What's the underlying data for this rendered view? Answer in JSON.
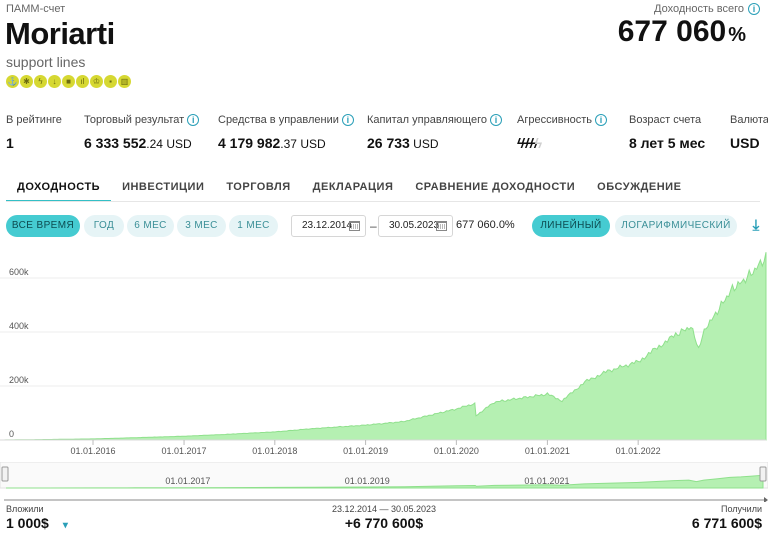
{
  "header": {
    "account_type": "ПАММ-счет",
    "name": "Moriarti",
    "subtitle": "support lines",
    "badge_icons": [
      "anchor-icon",
      "fire-icon",
      "bolt-icon",
      "pin-icon",
      "briefcase-icon",
      "chart-icon",
      "award-icon",
      "lock-icon",
      "building-icon"
    ],
    "yield_label": "Доходность всего",
    "yield_value": "677 060",
    "yield_unit": "%"
  },
  "stats": {
    "rating": {
      "label": "В рейтинге",
      "value": "1"
    },
    "trade_result": {
      "label": "Торговый результат",
      "int": "6 333 552",
      "dec": ".24",
      "cur": " USD"
    },
    "managed": {
      "label": "Средства в управлении",
      "int": "4 179 982",
      "dec": ".37",
      "cur": " USD"
    },
    "manager_capital": {
      "label": "Капитал управляющего",
      "int": "26 733",
      "cur": " USD"
    },
    "aggressiveness": {
      "label": "Агрессивность",
      "level": 4,
      "max": 5
    },
    "age": {
      "label": "Возраст счета",
      "value": "8 лет 5 мес"
    },
    "currency": {
      "label": "Валюта",
      "value": "USD"
    }
  },
  "tabs": [
    "ДОХОДНОСТЬ",
    "ИНВЕСТИЦИИ",
    "ТОРГОВЛЯ",
    "ДЕКЛАРАЦИЯ",
    "СРАВНЕНИЕ ДОХОДНОСТИ",
    "ОБСУЖДЕНИЕ"
  ],
  "filters": {
    "periods": [
      "ВСЕ ВРЕМЯ",
      "ГОД",
      "6 МЕС",
      "3 МЕС",
      "1 МЕС"
    ],
    "active_period": "ВСЕ ВРЕМЯ",
    "date_from": "23.12.2014",
    "dash": "–",
    "date_to": "30.05.2023",
    "range_yield": "677 060.0%",
    "scales": [
      "ЛИНЕЙНЫЙ",
      "ЛОГАРИФМИЧЕСКИЙ"
    ],
    "active_scale": "ЛИНЕЙНЫЙ"
  },
  "chart_data": {
    "type": "area",
    "title": "",
    "xlabel": "",
    "ylabel": "",
    "y_ticks": [
      0,
      200000,
      400000,
      600000
    ],
    "y_tick_labels": [
      "0",
      "200k",
      "400k",
      "600k"
    ],
    "ylim": [
      0,
      700000
    ],
    "x_tick_labels": [
      "01.01.2016",
      "01.01.2017",
      "01.01.2018",
      "01.01.2019",
      "01.01.2020",
      "01.01.2021",
      "01.01.2022"
    ],
    "xlim": [
      "2014-12-23",
      "2023-05-30"
    ],
    "grid": true,
    "fill_color": "#b5f0b2",
    "line_color": "#8fe08c",
    "series": [
      {
        "x": [
          "2014-12-23",
          "2015-06-01",
          "2016-01-01",
          "2016-06-01",
          "2017-01-01",
          "2017-06-01",
          "2018-01-01",
          "2018-06-01",
          "2019-01-01",
          "2019-06-01",
          "2020-01-01",
          "2020-03-15",
          "2020-03-20",
          "2020-06-01",
          "2021-01-01",
          "2021-03-01",
          "2021-06-01",
          "2021-09-01",
          "2022-01-01",
          "2022-03-01",
          "2022-06-01",
          "2022-08-01",
          "2022-09-01",
          "2022-10-01",
          "2022-11-01",
          "2022-12-01",
          "2023-01-15",
          "2023-03-01",
          "2023-04-15",
          "2023-05-30"
        ],
        "values": [
          0,
          1500,
          4000,
          8000,
          14000,
          20000,
          30000,
          42000,
          55000,
          68000,
          115000,
          135000,
          90000,
          140000,
          170000,
          145000,
          215000,
          255000,
          290000,
          330000,
          390000,
          420000,
          340000,
          420000,
          455000,
          500000,
          560000,
          590000,
          630000,
          677060
        ]
      }
    ],
    "navigator_x_labels": [
      "01.01.2017",
      "01.01.2019",
      "01.01.2021"
    ]
  },
  "footer": {
    "invested_label": "Вложили",
    "invested_value": "1 000$",
    "range_label": "23.12.2014 — 30.05.2023",
    "range_value": "+6 770 600$",
    "received_label": "Получили",
    "received_value": "6 771 600$"
  },
  "colors": {
    "accent": "#45cbd1",
    "accent_light": "#e6f4f6",
    "info": "#2a9fb8",
    "bolt": "#ef5a3d",
    "badge": "#d6d832"
  }
}
